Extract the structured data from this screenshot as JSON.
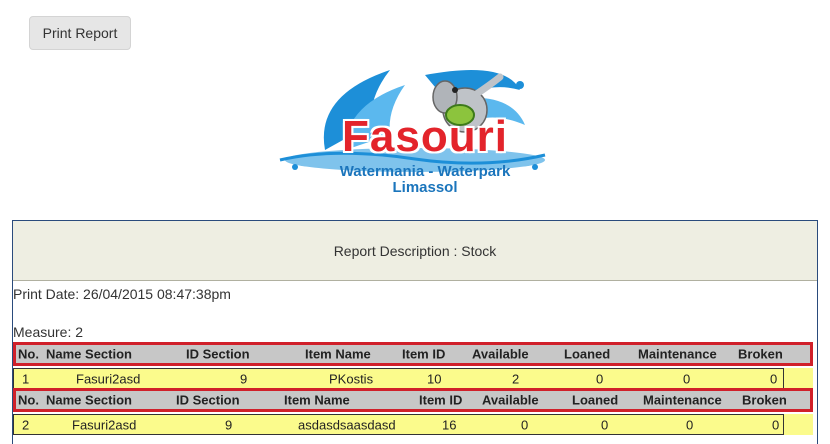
{
  "toolbar": {
    "print_label": "Print Report"
  },
  "logo": {
    "title": "Fasouri",
    "subtitle_line1": "Watermania - Waterpark",
    "subtitle_line2": "Limassol"
  },
  "report": {
    "description": "Report Description : Stock",
    "print_date": "Print Date: 26/04/2015 08:47:38pm",
    "measure": "Measure: 2"
  },
  "table": {
    "headers": [
      "No.",
      "Name Section",
      "ID Section",
      "Item Name",
      "Item ID",
      "Available",
      "Loaned",
      "Maintenance",
      "Broken"
    ],
    "rows": [
      [
        "1",
        "Fasuri2asd",
        "9",
        "PKostis",
        "10",
        "2",
        "0",
        "0",
        "0"
      ],
      [
        "2",
        "Fasuri2asd",
        "9",
        "asdasdsaasdasd",
        "16",
        "0",
        "0",
        "0",
        "0"
      ]
    ]
  },
  "colors": {
    "header_border": "#d0202a",
    "header_bg": "#c7c7c7",
    "row_bg": "#fbfb8c",
    "desc_bg": "#eeeee2",
    "logo_red": "#e3242b",
    "logo_blue": "#1b75bc"
  }
}
